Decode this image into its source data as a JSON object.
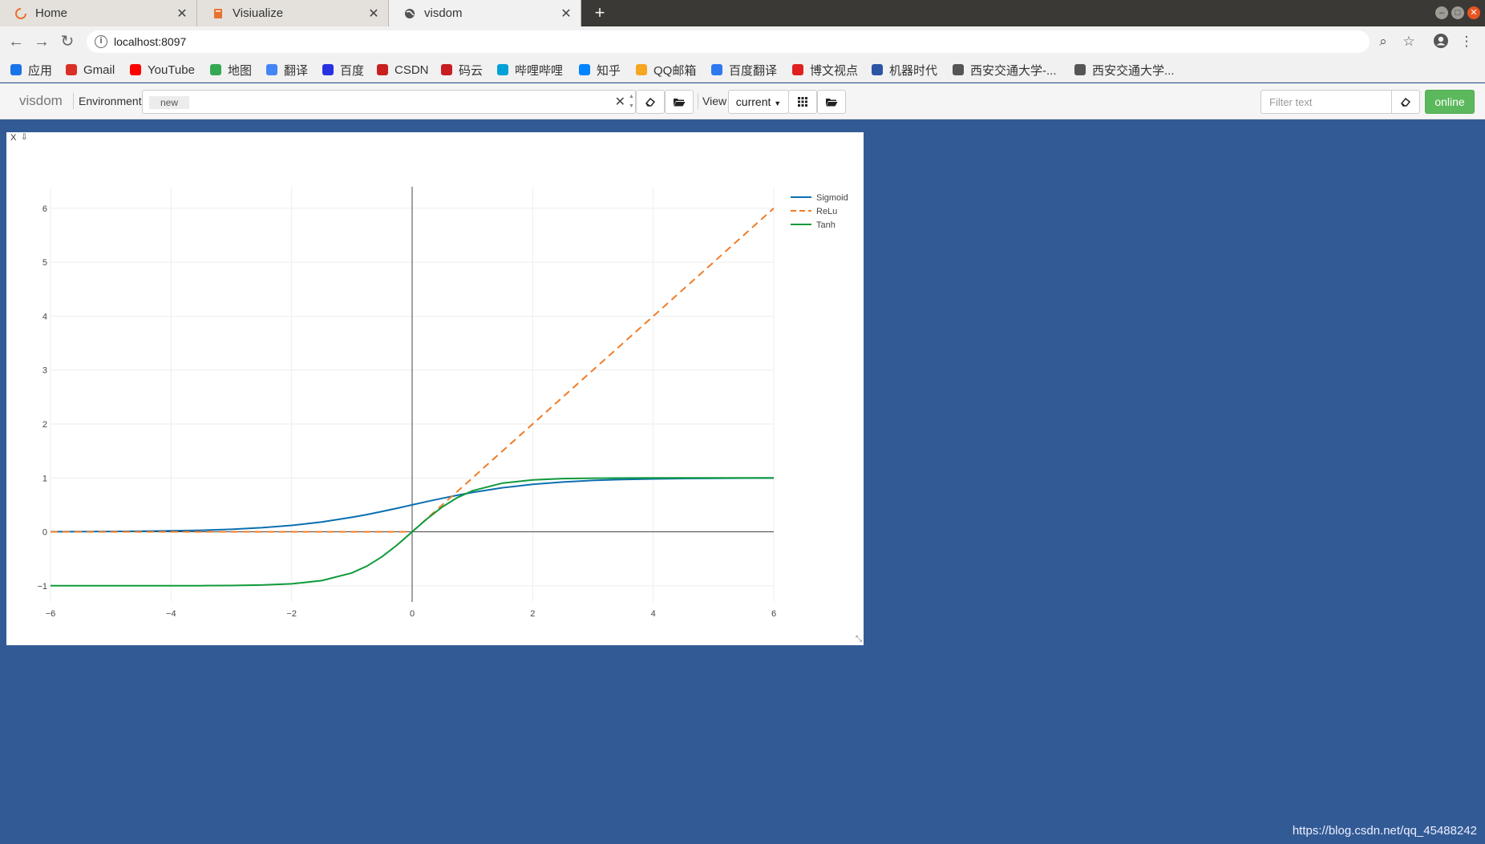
{
  "browser": {
    "tabs": [
      {
        "title": "Home",
        "icon": "spinner-icon"
      },
      {
        "title": "Visiualize",
        "icon": "book-icon"
      },
      {
        "title": "visdom",
        "icon": "globe-icon"
      }
    ],
    "url": "localhost:8097"
  },
  "bookmarks": [
    {
      "label": "应用",
      "icon": "apps-grid-icon",
      "color": "#1a73e8"
    },
    {
      "label": "Gmail",
      "icon": "gmail-icon",
      "color": "#d93025"
    },
    {
      "label": "YouTube",
      "icon": "youtube-icon",
      "color": "#ff0000"
    },
    {
      "label": "地图",
      "icon": "maps-icon",
      "color": "#34a853"
    },
    {
      "label": "翻译",
      "icon": "translate-icon",
      "color": "#4285f4"
    },
    {
      "label": "百度",
      "icon": "baidu-paw-icon",
      "color": "#2932e1"
    },
    {
      "label": "CSDN",
      "icon": "csdn-icon",
      "color": "#c91f1f"
    },
    {
      "label": "码云",
      "icon": "gitee-icon",
      "color": "#c71d23"
    },
    {
      "label": "哔哩哔哩",
      "icon": "bilibili-icon",
      "color": "#00a1d6"
    },
    {
      "label": "知乎",
      "icon": "zhihu-icon",
      "color": "#0084ff"
    },
    {
      "label": "QQ邮箱",
      "icon": "qqmail-icon",
      "color": "#f5a623"
    },
    {
      "label": "百度翻译",
      "icon": "baidu-translate-icon",
      "color": "#2f79ef"
    },
    {
      "label": "博文视点",
      "icon": "bowen-icon",
      "color": "#e02020"
    },
    {
      "label": "机器时代",
      "icon": "robot-icon",
      "color": "#2c55a3"
    },
    {
      "label": "西安交通大学-...",
      "icon": "globe-icon",
      "color": "#555555"
    },
    {
      "label": "西安交通大学...",
      "icon": "globe-icon",
      "color": "#555555"
    }
  ],
  "visdom": {
    "brand": "visdom",
    "environment_label": "Environment",
    "environment_chip": "new",
    "view_label": "View",
    "view_select": "current",
    "filter_placeholder": "Filter text",
    "status": "online",
    "status_color": "#5cb85c"
  },
  "pane": {
    "close_label": "X",
    "download_icon": "download-icon"
  },
  "chart_data": {
    "type": "line",
    "x_range": [
      -6,
      6
    ],
    "y_range": [
      -1.3,
      6.4
    ],
    "x_ticks": [
      -6,
      -4,
      -2,
      0,
      2,
      4,
      6
    ],
    "y_ticks": [
      -1,
      0,
      1,
      2,
      3,
      4,
      5,
      6
    ],
    "grid": true,
    "legend": "top-right",
    "x": [
      -6,
      -5.5,
      -5,
      -4.5,
      -4,
      -3.5,
      -3,
      -2.5,
      -2,
      -1.5,
      -1,
      -0.75,
      -0.5,
      -0.25,
      0,
      0.25,
      0.5,
      0.75,
      1,
      1.5,
      2,
      2.5,
      3,
      3.5,
      4,
      4.5,
      5,
      5.5,
      6
    ],
    "series": [
      {
        "name": "Sigmoid",
        "color": "#0b6fb0",
        "dash": "solid",
        "values": [
          0.002,
          0.004,
          0.007,
          0.011,
          0.018,
          0.029,
          0.047,
          0.076,
          0.119,
          0.182,
          0.269,
          0.321,
          0.378,
          0.438,
          0.5,
          0.562,
          0.622,
          0.679,
          0.731,
          0.818,
          0.881,
          0.924,
          0.953,
          0.971,
          0.982,
          0.989,
          0.993,
          0.996,
          0.998
        ]
      },
      {
        "name": "ReLu",
        "color": "#f07b27",
        "dash": "dashed",
        "values": [
          0,
          0,
          0,
          0,
          0,
          0,
          0,
          0,
          0,
          0,
          0,
          0,
          0,
          0,
          0,
          0.25,
          0.5,
          0.75,
          1,
          1.5,
          2,
          2.5,
          3,
          3.5,
          4,
          4.5,
          5,
          5.5,
          6
        ]
      },
      {
        "name": "Tanh",
        "color": "#0f9a3a",
        "dash": "solid",
        "values": [
          -1,
          -1,
          -1,
          -1,
          -0.999,
          -0.998,
          -0.995,
          -0.987,
          -0.964,
          -0.905,
          -0.762,
          -0.635,
          -0.462,
          -0.245,
          0,
          0.245,
          0.462,
          0.635,
          0.762,
          0.905,
          0.964,
          0.987,
          0.995,
          0.998,
          0.999,
          1,
          1,
          1,
          1
        ]
      }
    ]
  },
  "footer": {
    "credit": "https://blog.csdn.net/qq_45488242"
  }
}
